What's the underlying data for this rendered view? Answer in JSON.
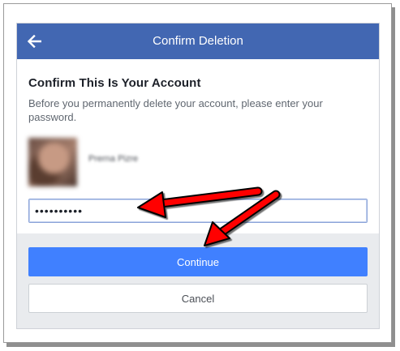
{
  "header": {
    "title": "Confirm Deletion",
    "back_icon": "arrow-left-icon"
  },
  "account": {
    "heading": "Confirm This Is Your Account",
    "description": "Before you permanently delete your account, please enter your password.",
    "user_name": "Prerna Pizre",
    "avatar": "profile-photo"
  },
  "password": {
    "value": "••••••••••"
  },
  "buttons": {
    "continue_label": "Continue",
    "cancel_label": "Cancel"
  },
  "colors": {
    "header_bg": "#4267b2",
    "continue_bg": "#4080ff",
    "footer_bg": "#e9ebee",
    "annotation_arrow": "#ff0000"
  }
}
